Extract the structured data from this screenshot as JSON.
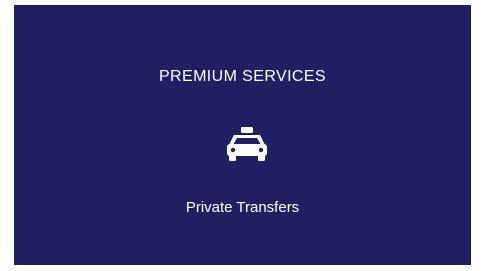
{
  "card": {
    "heading": "PREMIUM SERVICES",
    "icon": "taxi-icon",
    "label": "Private Transfers",
    "background_color": "#1f1f62",
    "text_color": "#ffffff"
  }
}
